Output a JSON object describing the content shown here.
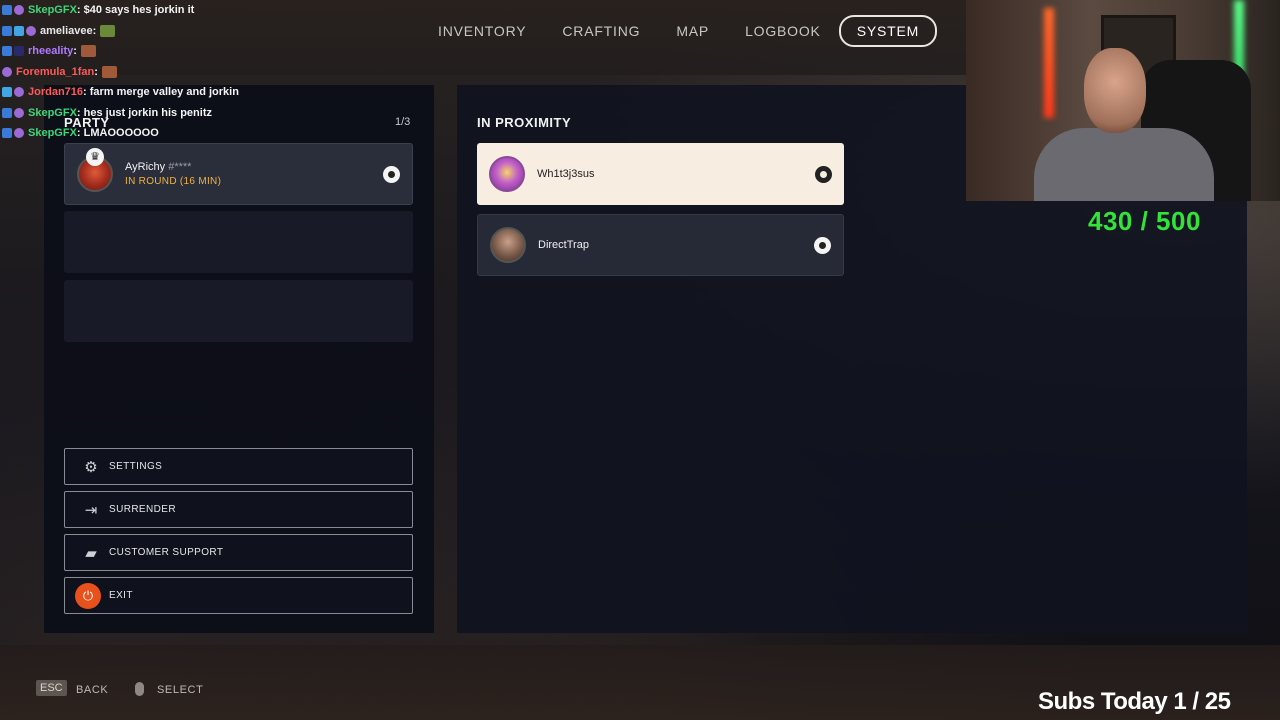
{
  "nav": {
    "tabs": [
      {
        "label": "INVENTORY"
      },
      {
        "label": "CRAFTING"
      },
      {
        "label": "MAP"
      },
      {
        "label": "LOGBOOK"
      },
      {
        "label": "SYSTEM",
        "active": true
      }
    ]
  },
  "party": {
    "title": "PARTY",
    "count": "1/3",
    "members": [
      {
        "name": "AyRichy",
        "tag": "#****",
        "status": "IN ROUND (16 MIN)",
        "platform_icon": "steam-icon",
        "leader": true
      }
    ]
  },
  "proximity": {
    "title": "IN PROXIMITY",
    "players": [
      {
        "name": "Wh1t3j3sus",
        "platform_icon": "steam-icon"
      },
      {
        "name": "DirectTrap",
        "platform_icon": "steam-icon"
      }
    ]
  },
  "menu": {
    "settings": "SETTINGS",
    "surrender": "SURRENDER",
    "support": "CUSTOMER SUPPORT",
    "exit": "EXIT"
  },
  "hints": {
    "back_key": "ESC",
    "back_label": "BACK",
    "select_label": "SELECT"
  },
  "chat": [
    {
      "user": "SkepGFX",
      "msg": " : $40 says hes jorkin it",
      "color": "#3fd67a"
    },
    {
      "user": "ameliavee",
      "msg": " : ",
      "color": "#e8e8e8"
    },
    {
      "user": "rheeality",
      "msg": " : ",
      "color": "#b07aff"
    },
    {
      "user": "Foremula_1fan",
      "msg": " : ",
      "color": "#ff5a5a"
    },
    {
      "user": "Jordan716",
      "msg": " : farm merge valley and jorkin",
      "color": "#ff5a5a"
    },
    {
      "user": "SkepGFX",
      "msg": " : hes just jorkin his penitz",
      "color": "#3fd67a"
    },
    {
      "user": "SkepGFX",
      "msg": " : LMAOOOOOO",
      "color": "#3fd67a"
    }
  ],
  "overlay": {
    "sub_goal": "430 / 500",
    "subs_today": "Subs Today  1 / 25"
  },
  "colors": {
    "accent_orange": "#e8501c",
    "status_yellow": "#f0b23a",
    "goal_green": "#33e33a"
  }
}
